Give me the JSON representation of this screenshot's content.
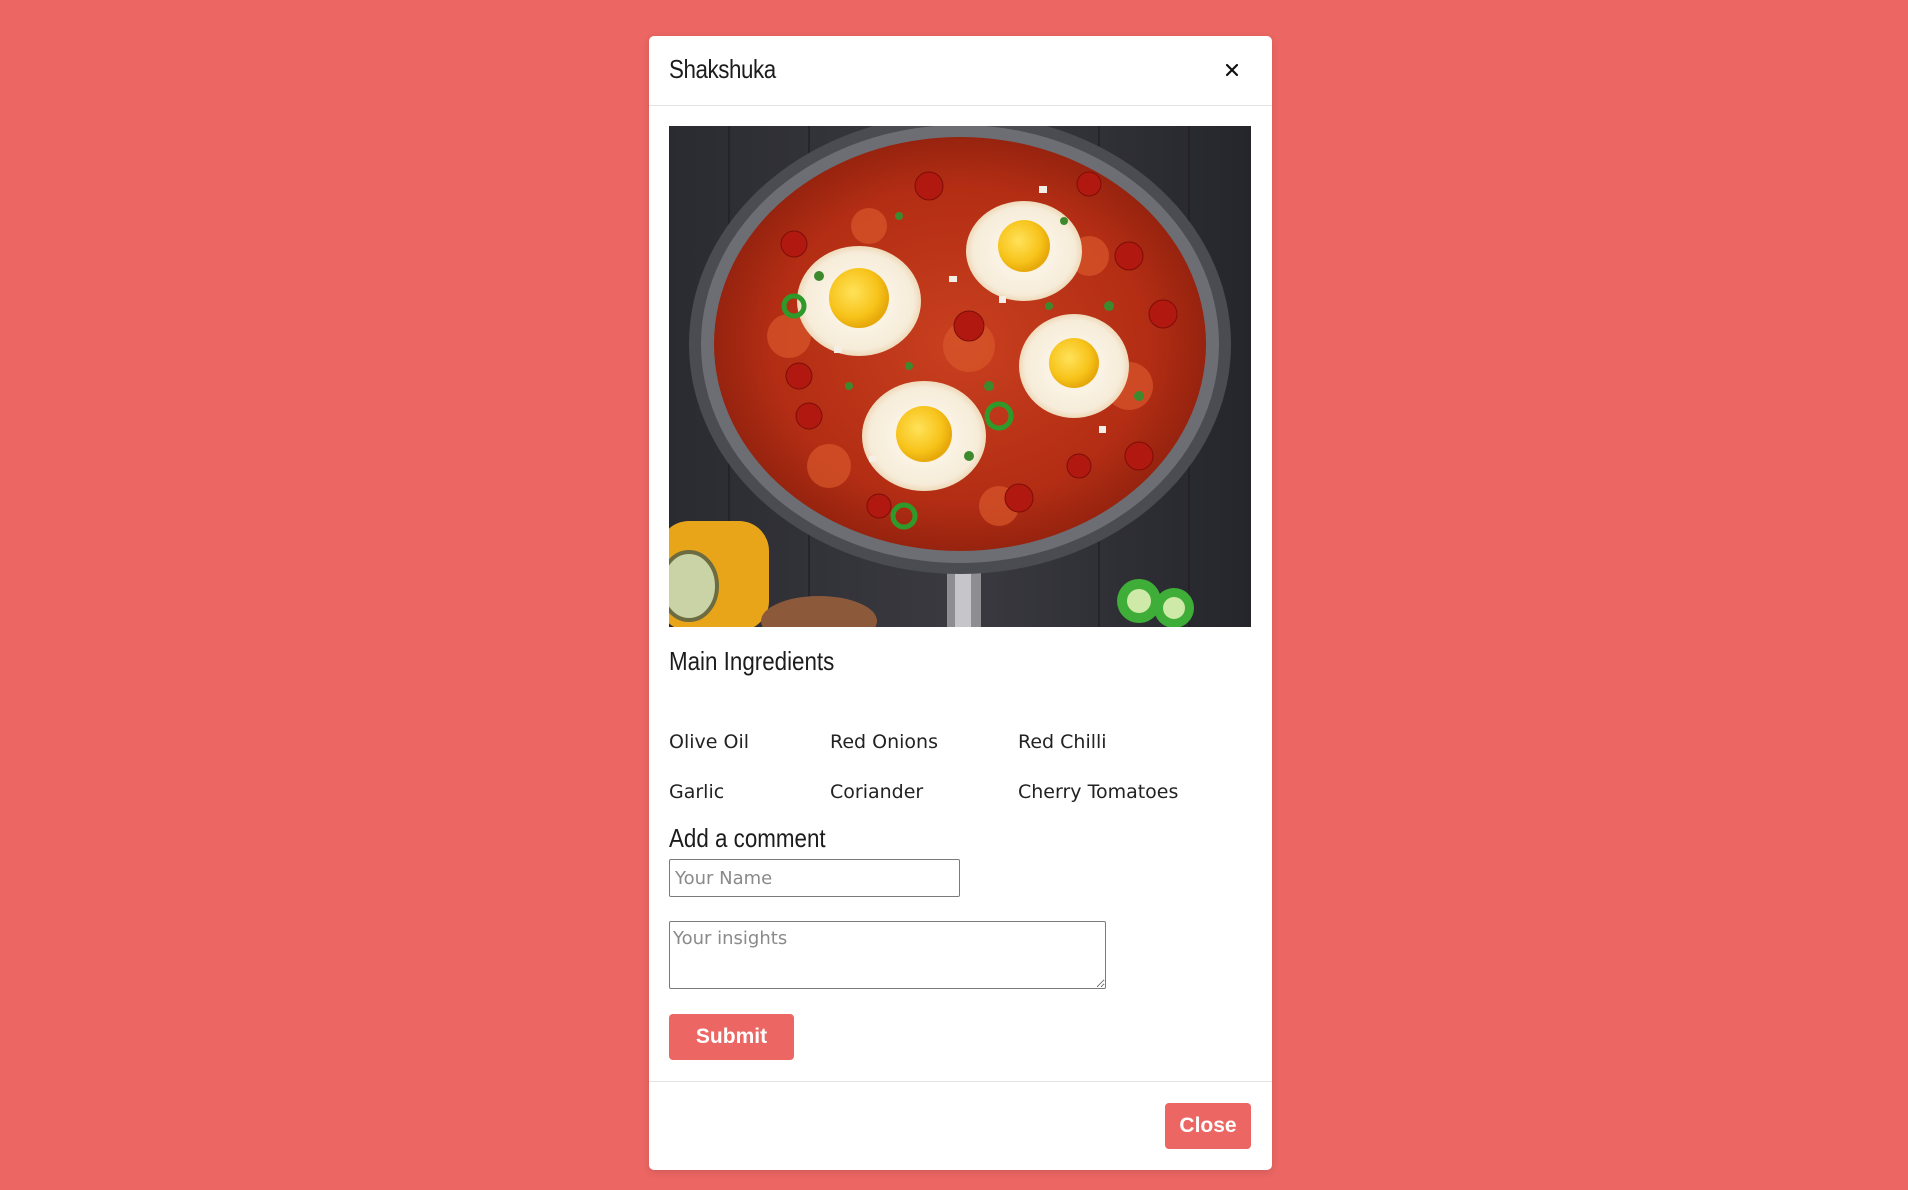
{
  "modal": {
    "title": "Shakshuka",
    "close_icon": "close-x-icon",
    "image_alt": "Shakshuka in a skillet"
  },
  "ingredients": {
    "heading": "Main Ingredients",
    "items": [
      "Olive Oil",
      "Red Onions",
      "Red Chilli",
      "Garlic",
      "Coriander",
      "Cherry Tomatoes"
    ]
  },
  "comment": {
    "heading": "Add a comment",
    "name_placeholder": "Your Name",
    "name_value": "",
    "insights_placeholder": "Your insights",
    "insights_value": "",
    "submit_label": "Submit"
  },
  "footer": {
    "close_label": "Close"
  },
  "colors": {
    "background": "#ec6663",
    "accent": "#ec6663"
  }
}
